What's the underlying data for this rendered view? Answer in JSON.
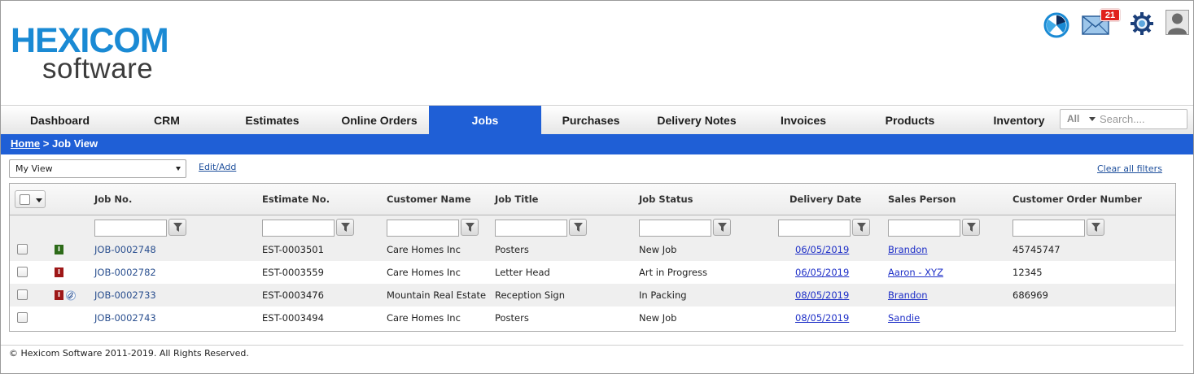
{
  "logo": {
    "line1": "HEXICOM",
    "line2": "software"
  },
  "header": {
    "notification_count": "21",
    "icons": [
      "chart-pie-icon",
      "mail-icon",
      "gear-icon",
      "user-avatar-icon"
    ]
  },
  "nav": {
    "items": [
      {
        "label": "Dashboard",
        "active": false
      },
      {
        "label": "CRM",
        "active": false
      },
      {
        "label": "Estimates",
        "active": false
      },
      {
        "label": "Online Orders",
        "active": false
      },
      {
        "label": "Jobs",
        "active": true
      },
      {
        "label": "Purchases",
        "active": false
      },
      {
        "label": "Delivery Notes",
        "active": false
      },
      {
        "label": "Invoices",
        "active": false
      },
      {
        "label": "Products",
        "active": false
      },
      {
        "label": "Inventory",
        "active": false
      }
    ],
    "search": {
      "scope": "All",
      "placeholder": "Search...."
    }
  },
  "breadcrumb": {
    "home": "Home",
    "separator": ">",
    "current": "Job View"
  },
  "toolbar": {
    "view_value": "My View",
    "edit_add": "Edit/Add",
    "clear_filters": "Clear all filters"
  },
  "grid": {
    "columns": [
      "Job No.",
      "Estimate No.",
      "Customer Name",
      "Job Title",
      "Job Status",
      "Delivery Date",
      "Sales Person",
      "Customer Order Number"
    ],
    "rows": [
      {
        "flag": "I",
        "flag_color": "#2d6b19",
        "attachment": false,
        "job_no": "JOB-0002748",
        "estimate_no": "EST-0003501",
        "customer": "Care Homes Inc",
        "title": "Posters",
        "status": "New Job",
        "delivery": "06/05/2019",
        "sales": "Brandon",
        "order_no": "45745747"
      },
      {
        "flag": "I",
        "flag_color": "#9e1717",
        "attachment": false,
        "job_no": "JOB-0002782",
        "estimate_no": "EST-0003559",
        "customer": "Care Homes Inc",
        "title": "Letter Head",
        "status": "Art in Progress",
        "delivery": "06/05/2019",
        "sales": "Aaron - XYZ",
        "order_no": "12345"
      },
      {
        "flag": "I",
        "flag_color": "#9e1717",
        "attachment": true,
        "job_no": "JOB-0002733",
        "estimate_no": "EST-0003476",
        "customer": "Mountain Real Estate",
        "title": "Reception Sign",
        "status": "In Packing",
        "delivery": "08/05/2019",
        "sales": "Brandon",
        "order_no": "686969"
      },
      {
        "flag": "",
        "flag_color": "",
        "attachment": false,
        "job_no": "JOB-0002743",
        "estimate_no": "EST-0003494",
        "customer": "Care Homes Inc",
        "title": "Posters",
        "status": "New Job",
        "delivery": "08/05/2019",
        "sales": "Sandie",
        "order_no": ""
      }
    ]
  },
  "footer": {
    "copyright": "© Hexicom Software 2011-2019. All Rights Reserved."
  },
  "colors": {
    "brand_blue": "#1f5fd6",
    "logo_blue": "#1a8ad4",
    "badge_red": "#e0211d"
  }
}
